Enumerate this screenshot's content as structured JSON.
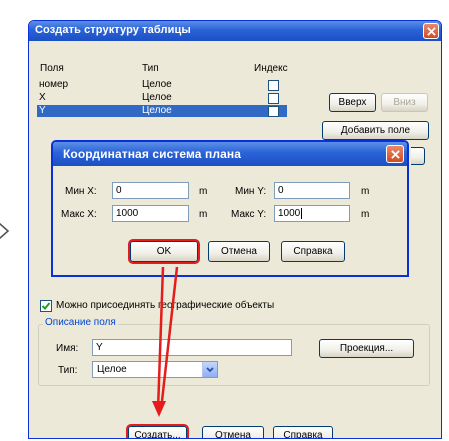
{
  "main_window": {
    "title": "Создать структуру таблицы",
    "columns": {
      "fields": "Поля",
      "type": "Тип",
      "index": "Индекс"
    },
    "fields": [
      {
        "name": "номер",
        "type": "Целое",
        "selected": false
      },
      {
        "name": "X",
        "type": "Целое",
        "selected": false
      },
      {
        "name": "Y",
        "type": "Целое",
        "selected": true
      }
    ],
    "buttons": {
      "up": "Вверх",
      "down": "Вниз",
      "add_field": "Добавить поле"
    },
    "geo_checkbox_label": "Можно присоединять географические объекты",
    "geo_checkbox_checked": true,
    "field_description": {
      "legend": "Описание поля",
      "name_label": "Имя:",
      "name_value": "Y",
      "type_label": "Тип:",
      "type_value": "Целое",
      "projection_button": "Проекция..."
    },
    "footer": {
      "create": "Создать...",
      "cancel": "Отмена",
      "help": "Справка"
    }
  },
  "coord_dialog": {
    "title": "Координатная система плана",
    "min_x_label": "Мин X:",
    "min_x_value": "0",
    "min_y_label": "Мин Y:",
    "min_y_value": "0",
    "max_x_label": "Макс X:",
    "max_x_value": "1000",
    "max_y_label": "Макс Y:",
    "max_y_value": "1000",
    "unit": "m",
    "buttons": {
      "ok": "OK",
      "cancel": "Отмена",
      "help": "Справка"
    }
  },
  "colors": {
    "title_bar": "#2a63d8",
    "selection": "#316ac5",
    "highlight": "#e41c1c",
    "dialog_bg": "#ece9d8",
    "group_legend": "#0046d5"
  }
}
